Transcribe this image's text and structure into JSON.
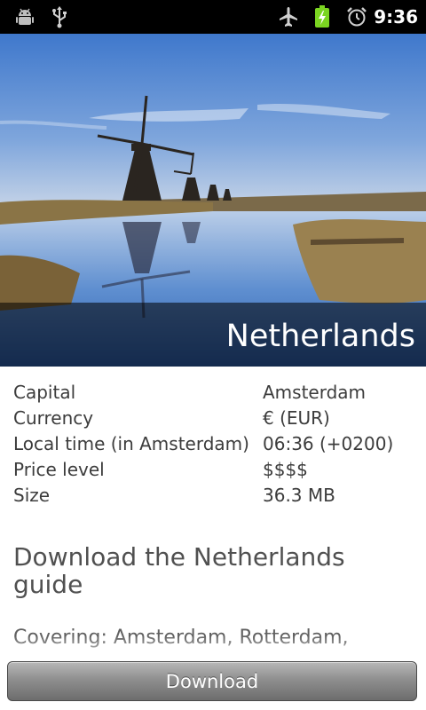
{
  "status_bar": {
    "time": "9:36",
    "icons": [
      "android-debug-icon",
      "usb-icon",
      "airplane-mode-icon",
      "battery-charging-icon",
      "alarm-clock-icon"
    ]
  },
  "hero": {
    "title": "Netherlands"
  },
  "info": {
    "rows": [
      {
        "label": "Capital",
        "value": "Amsterdam"
      },
      {
        "label": "Currency",
        "value": "€ (EUR)"
      },
      {
        "label": "Local time (in Amsterdam)",
        "value": "06:36 (+0200)"
      },
      {
        "label": "Price level",
        "value": "$$$$"
      },
      {
        "label": "Size",
        "value": "36.3 MB"
      }
    ]
  },
  "download": {
    "title": "Download the Netherlands guide",
    "covering": "Covering: Amsterdam, Rotterdam,",
    "button_label": "Download"
  },
  "colors": {
    "status_bar": "#000000",
    "battery": "#7bd521",
    "text_primary": "#3c3c3c",
    "title_text": "#505050"
  }
}
